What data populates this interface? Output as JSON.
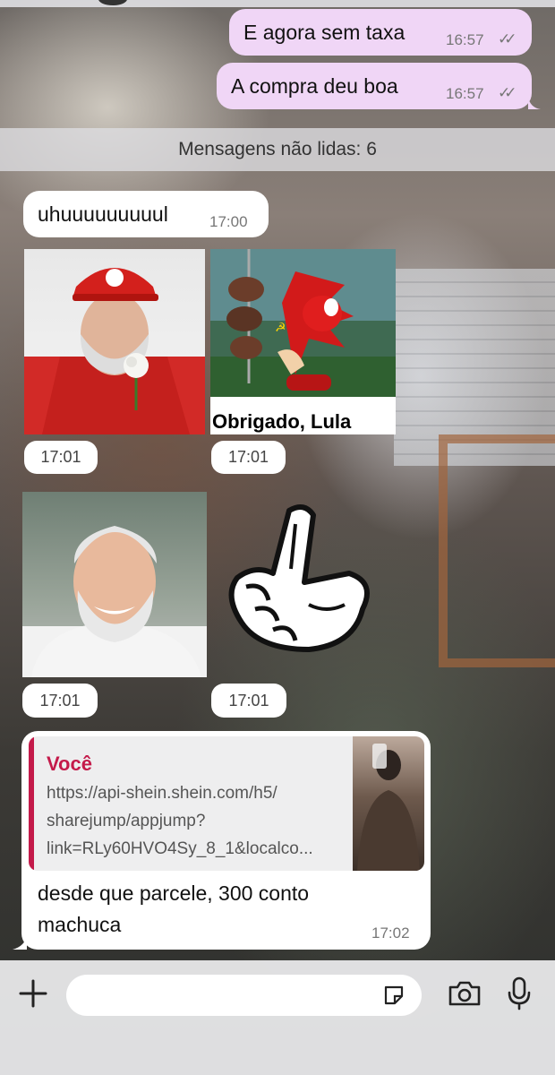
{
  "messages": {
    "out1": {
      "text": "E agora sem taxa",
      "time": "16:57",
      "ticks": "✓✓"
    },
    "out2": {
      "text": "A compra deu boa",
      "time": "16:57",
      "ticks": "✓✓"
    },
    "unread_label": "Mensagens não lidas: 6",
    "in1": {
      "text": "uhuuuuuuuuul",
      "time": "17:00"
    },
    "img1": {
      "time": "17:01"
    },
    "img2": {
      "caption": "Obrigado, Lula",
      "time": "17:01"
    },
    "img3": {
      "time": "17:01"
    },
    "img4": {
      "time": "17:01"
    },
    "reply": {
      "author": "Você",
      "link_line1": "https://api-shein.shein.com/h5/",
      "link_line2": "sharejump/appjump?",
      "link_line3": "link=RLy60HVO4Sy_8_1&localco...",
      "text_line1": "desde que parcele, 300 conto",
      "text_line2": "machuca",
      "time": "17:02"
    }
  },
  "colors": {
    "outgoing_bubble": "#f0d6f6",
    "incoming_bubble": "#ffffff",
    "reply_accent": "#c41a4a"
  },
  "icons": {
    "attach": "plus-icon",
    "sticker": "sticker-icon",
    "camera": "camera-icon",
    "mic": "microphone-icon"
  }
}
